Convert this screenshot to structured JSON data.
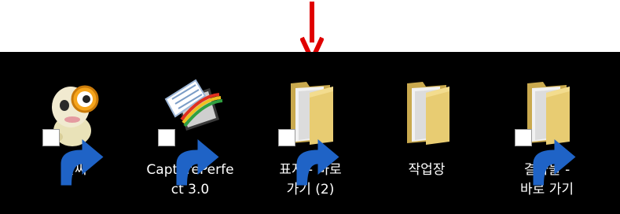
{
  "desktop": {
    "icons": [
      {
        "name": "alssee",
        "line1": "알씨",
        "line2": "",
        "shortcut": true
      },
      {
        "name": "captureperfect",
        "line1": "CapturePerfe",
        "line2": "ct 3.0",
        "shortcut": true
      },
      {
        "name": "pyoji-shortcut",
        "line1": "표지 - 바로",
        "line2": "가기 (2)",
        "shortcut": true
      },
      {
        "name": "jakeopjang",
        "line1": "작업장",
        "line2": "",
        "shortcut": false
      },
      {
        "name": "gyeolgwamul-shortcut",
        "line1": "결과물 -",
        "line2": "바로 가기",
        "shortcut": true
      }
    ]
  },
  "annotation": {
    "arrow_color": "#e00000",
    "points_to": "pyoji-shortcut"
  },
  "colors": {
    "desktop_bg": "#000000",
    "folder": "#e8cc72",
    "label": "#ffffff"
  }
}
